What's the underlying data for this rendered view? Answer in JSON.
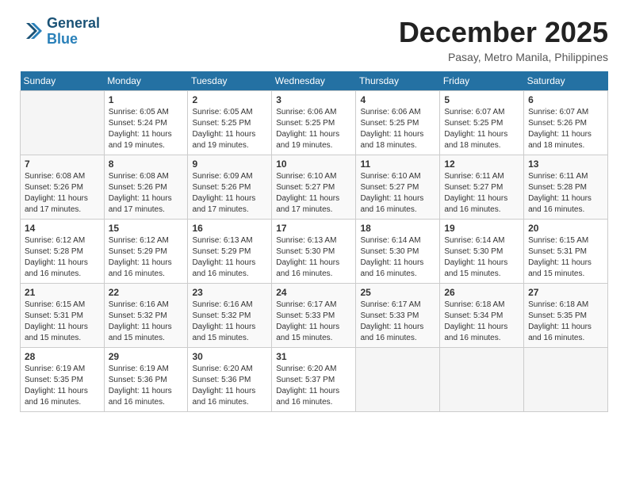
{
  "header": {
    "logo_line1": "General",
    "logo_line2": "Blue",
    "month": "December 2025",
    "location": "Pasay, Metro Manila, Philippines"
  },
  "weekdays": [
    "Sunday",
    "Monday",
    "Tuesday",
    "Wednesday",
    "Thursday",
    "Friday",
    "Saturday"
  ],
  "weeks": [
    [
      {
        "day": "",
        "info": ""
      },
      {
        "day": "1",
        "info": "Sunrise: 6:05 AM\nSunset: 5:24 PM\nDaylight: 11 hours\nand 19 minutes."
      },
      {
        "day": "2",
        "info": "Sunrise: 6:05 AM\nSunset: 5:25 PM\nDaylight: 11 hours\nand 19 minutes."
      },
      {
        "day": "3",
        "info": "Sunrise: 6:06 AM\nSunset: 5:25 PM\nDaylight: 11 hours\nand 19 minutes."
      },
      {
        "day": "4",
        "info": "Sunrise: 6:06 AM\nSunset: 5:25 PM\nDaylight: 11 hours\nand 18 minutes."
      },
      {
        "day": "5",
        "info": "Sunrise: 6:07 AM\nSunset: 5:25 PM\nDaylight: 11 hours\nand 18 minutes."
      },
      {
        "day": "6",
        "info": "Sunrise: 6:07 AM\nSunset: 5:26 PM\nDaylight: 11 hours\nand 18 minutes."
      }
    ],
    [
      {
        "day": "7",
        "info": "Sunrise: 6:08 AM\nSunset: 5:26 PM\nDaylight: 11 hours\nand 17 minutes."
      },
      {
        "day": "8",
        "info": "Sunrise: 6:08 AM\nSunset: 5:26 PM\nDaylight: 11 hours\nand 17 minutes."
      },
      {
        "day": "9",
        "info": "Sunrise: 6:09 AM\nSunset: 5:26 PM\nDaylight: 11 hours\nand 17 minutes."
      },
      {
        "day": "10",
        "info": "Sunrise: 6:10 AM\nSunset: 5:27 PM\nDaylight: 11 hours\nand 17 minutes."
      },
      {
        "day": "11",
        "info": "Sunrise: 6:10 AM\nSunset: 5:27 PM\nDaylight: 11 hours\nand 16 minutes."
      },
      {
        "day": "12",
        "info": "Sunrise: 6:11 AM\nSunset: 5:27 PM\nDaylight: 11 hours\nand 16 minutes."
      },
      {
        "day": "13",
        "info": "Sunrise: 6:11 AM\nSunset: 5:28 PM\nDaylight: 11 hours\nand 16 minutes."
      }
    ],
    [
      {
        "day": "14",
        "info": "Sunrise: 6:12 AM\nSunset: 5:28 PM\nDaylight: 11 hours\nand 16 minutes."
      },
      {
        "day": "15",
        "info": "Sunrise: 6:12 AM\nSunset: 5:29 PM\nDaylight: 11 hours\nand 16 minutes."
      },
      {
        "day": "16",
        "info": "Sunrise: 6:13 AM\nSunset: 5:29 PM\nDaylight: 11 hours\nand 16 minutes."
      },
      {
        "day": "17",
        "info": "Sunrise: 6:13 AM\nSunset: 5:30 PM\nDaylight: 11 hours\nand 16 minutes."
      },
      {
        "day": "18",
        "info": "Sunrise: 6:14 AM\nSunset: 5:30 PM\nDaylight: 11 hours\nand 16 minutes."
      },
      {
        "day": "19",
        "info": "Sunrise: 6:14 AM\nSunset: 5:30 PM\nDaylight: 11 hours\nand 15 minutes."
      },
      {
        "day": "20",
        "info": "Sunrise: 6:15 AM\nSunset: 5:31 PM\nDaylight: 11 hours\nand 15 minutes."
      }
    ],
    [
      {
        "day": "21",
        "info": "Sunrise: 6:15 AM\nSunset: 5:31 PM\nDaylight: 11 hours\nand 15 minutes."
      },
      {
        "day": "22",
        "info": "Sunrise: 6:16 AM\nSunset: 5:32 PM\nDaylight: 11 hours\nand 15 minutes."
      },
      {
        "day": "23",
        "info": "Sunrise: 6:16 AM\nSunset: 5:32 PM\nDaylight: 11 hours\nand 15 minutes."
      },
      {
        "day": "24",
        "info": "Sunrise: 6:17 AM\nSunset: 5:33 PM\nDaylight: 11 hours\nand 15 minutes."
      },
      {
        "day": "25",
        "info": "Sunrise: 6:17 AM\nSunset: 5:33 PM\nDaylight: 11 hours\nand 16 minutes."
      },
      {
        "day": "26",
        "info": "Sunrise: 6:18 AM\nSunset: 5:34 PM\nDaylight: 11 hours\nand 16 minutes."
      },
      {
        "day": "27",
        "info": "Sunrise: 6:18 AM\nSunset: 5:35 PM\nDaylight: 11 hours\nand 16 minutes."
      }
    ],
    [
      {
        "day": "28",
        "info": "Sunrise: 6:19 AM\nSunset: 5:35 PM\nDaylight: 11 hours\nand 16 minutes."
      },
      {
        "day": "29",
        "info": "Sunrise: 6:19 AM\nSunset: 5:36 PM\nDaylight: 11 hours\nand 16 minutes."
      },
      {
        "day": "30",
        "info": "Sunrise: 6:20 AM\nSunset: 5:36 PM\nDaylight: 11 hours\nand 16 minutes."
      },
      {
        "day": "31",
        "info": "Sunrise: 6:20 AM\nSunset: 5:37 PM\nDaylight: 11 hours\nand 16 minutes."
      },
      {
        "day": "",
        "info": ""
      },
      {
        "day": "",
        "info": ""
      },
      {
        "day": "",
        "info": ""
      }
    ]
  ]
}
